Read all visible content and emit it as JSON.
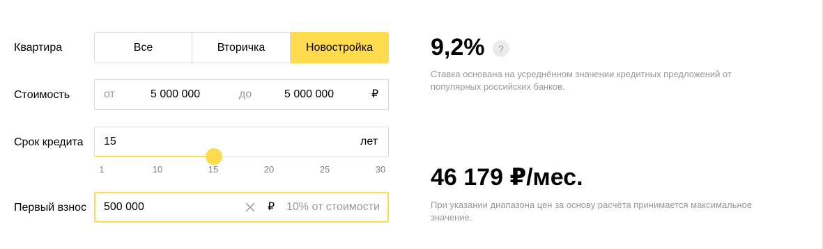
{
  "form": {
    "flat_label": "Квартира",
    "flat_options": [
      "Все",
      "Вторичка",
      "Новостройка"
    ],
    "flat_selected": "Новостройка",
    "cost_label": "Стоимость",
    "cost_from_prefix": "от",
    "cost_from_value": "5 000 000",
    "cost_to_prefix": "до",
    "cost_to_value": "5 000 000",
    "currency": "₽",
    "term_label": "Срок кредита",
    "term_value": "15",
    "term_unit": "лет",
    "term_ticks": [
      "1",
      "10",
      "15",
      "20",
      "25",
      "30"
    ],
    "term_slider_value": 15,
    "down_label": "Первый взнос",
    "down_value": "500 000",
    "down_currency": "₽",
    "down_percent_text": "10% от стоимости"
  },
  "result": {
    "rate": "9,2%",
    "help": "?",
    "rate_note": "Ставка основана на усреднённом значении кредитных предложений от популярных российских банков.",
    "payment": "46 179 ₽/мес.",
    "payment_note": "При указании диапазона цен за основу расчёта принимается максимальное значение."
  },
  "colors": {
    "accent": "#ffdb4d",
    "border": "#d9d9d9",
    "muted": "#999999"
  }
}
